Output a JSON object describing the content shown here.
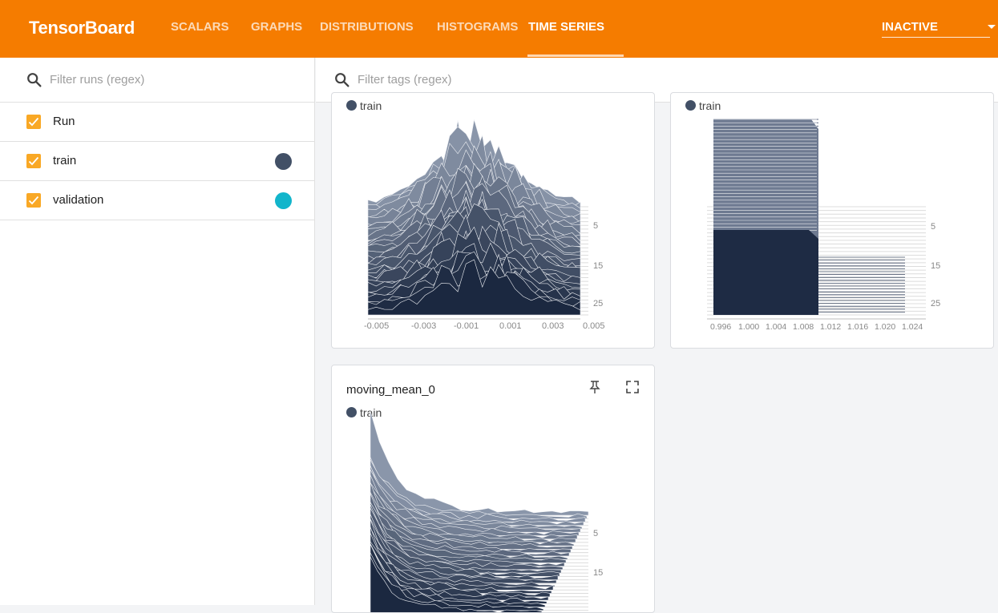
{
  "app": {
    "title": "TensorBoard"
  },
  "nav": {
    "tabs": [
      {
        "label": "SCALARS"
      },
      {
        "label": "GRAPHS"
      },
      {
        "label": "DISTRIBUTIONS"
      },
      {
        "label": "HISTOGRAMS"
      },
      {
        "label": "TIME SERIES"
      }
    ],
    "active_tab": "TIME SERIES",
    "reload_status": "INACTIVE"
  },
  "sidebar": {
    "search_placeholder": "Filter runs (regex)",
    "runs": [
      {
        "label": "Run",
        "checked": true,
        "color": null
      },
      {
        "label": "train",
        "checked": true,
        "color": "#425066"
      },
      {
        "label": "validation",
        "checked": true,
        "color": "#12b5cb"
      }
    ]
  },
  "main": {
    "search_placeholder": "Filter tags (regex)",
    "cards": [
      {
        "legend": "train",
        "x_ticks": [
          "-0.005",
          "-0.003",
          "-0.001",
          "0.001",
          "0.003",
          "0.005"
        ],
        "y_ticks": [
          "5",
          "15",
          "25"
        ]
      },
      {
        "legend": "train",
        "x_ticks": [
          "0.996",
          "1.000",
          "1.004",
          "1.008",
          "1.012",
          "1.016",
          "1.020",
          "1.024"
        ],
        "y_ticks": [
          "5",
          "15",
          "25"
        ]
      },
      {
        "title": "moving_mean_0",
        "legend": "train",
        "y_ticks": [
          "5",
          "15"
        ]
      }
    ]
  },
  "colors": {
    "accent": "#f57c00",
    "series_train": "#425066",
    "series_validation": "#12b5cb"
  }
}
